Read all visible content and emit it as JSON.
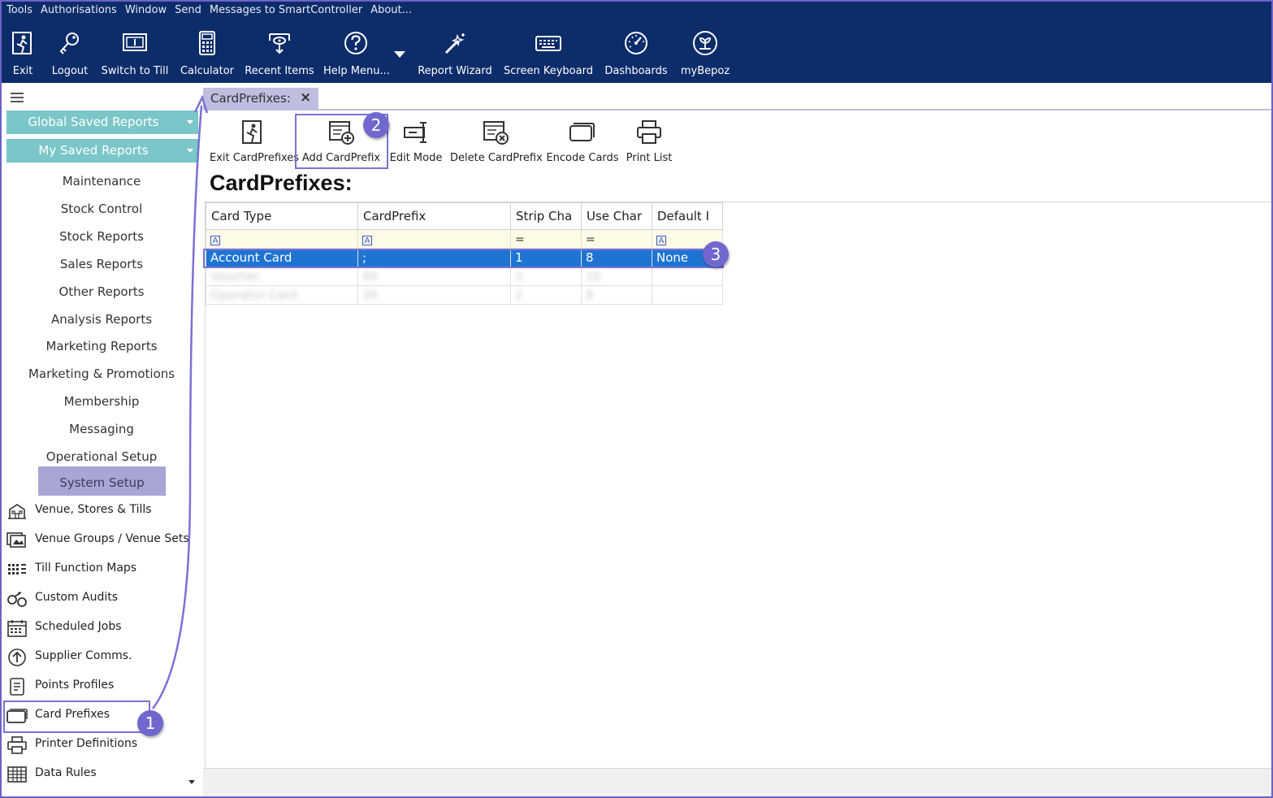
{
  "menubar": {
    "items": [
      "Tools",
      "Authorisations",
      "Window",
      "Send",
      "Messages to SmartController",
      "About..."
    ]
  },
  "toolbar": {
    "buttons": [
      {
        "label": "Exit",
        "icon": "exit-icon"
      },
      {
        "label": "Logout",
        "icon": "key-icon"
      },
      {
        "label": "Switch to Till",
        "icon": "till-icon"
      },
      {
        "label": "Calculator",
        "icon": "calculator-icon"
      },
      {
        "label": "Recent Items",
        "icon": "recent-items-icon"
      },
      {
        "label": "Help Menu...",
        "icon": "help-icon"
      },
      {
        "label": "Report Wizard",
        "icon": "wand-icon"
      },
      {
        "label": "Screen Keyboard",
        "icon": "keyboard-icon"
      },
      {
        "label": "Dashboards",
        "icon": "dashboard-gauge-icon"
      },
      {
        "label": "myBepoz",
        "icon": "mybepoz-logo-icon"
      }
    ]
  },
  "sidebar": {
    "global_saved_reports": "Global Saved Reports",
    "my_saved_reports": "My Saved Reports",
    "categories": [
      "Maintenance",
      "Stock Control",
      "Stock Reports",
      "Sales Reports",
      "Other Reports",
      "Analysis Reports",
      "Marketing Reports",
      "Marketing & Promotions",
      "Membership",
      "Messaging",
      "Operational Setup",
      "System Setup"
    ],
    "selected_category": "System Setup",
    "subitems": [
      {
        "label": "Venue, Stores & Tills",
        "icon": "venue-building-icon"
      },
      {
        "label": "Venue Groups / Venue Sets",
        "icon": "venue-groups-icon"
      },
      {
        "label": "Till Function Maps",
        "icon": "function-map-grid-icon"
      },
      {
        "label": "Custom Audits",
        "icon": "custom-audits-icon"
      },
      {
        "label": "Scheduled Jobs",
        "icon": "calendar-icon"
      },
      {
        "label": "Supplier Comms.",
        "icon": "upload-arrow-icon"
      },
      {
        "label": "Points Profiles",
        "icon": "document-icon"
      },
      {
        "label": "Card Prefixes",
        "icon": "card-icon"
      },
      {
        "label": "Printer Definitions",
        "icon": "printer-icon"
      },
      {
        "label": "Data Rules",
        "icon": "data-grid-icon"
      }
    ]
  },
  "tab": {
    "label": "CardPrefixes:",
    "close": "×"
  },
  "subtoolbar": {
    "buttons": [
      {
        "label": "Exit CardPrefixes",
        "icon": "exit-icon"
      },
      {
        "label": "Add CardPrefix",
        "icon": "add-cardprefix-icon"
      },
      {
        "label": "Edit Mode",
        "icon": "edit-mode-icon"
      },
      {
        "label": "Delete CardPrefix",
        "icon": "delete-cardprefix-icon"
      },
      {
        "label": "Encode Cards",
        "icon": "encode-cards-icon"
      },
      {
        "label": "Print List",
        "icon": "printer-icon"
      }
    ]
  },
  "page_title": "CardPrefixes:",
  "grid": {
    "columns": [
      "Card Type",
      "CardPrefix",
      "Strip Cha",
      "Use Char",
      "Default I"
    ],
    "filters": [
      "A",
      "A",
      "=",
      "=",
      "A"
    ],
    "rows": [
      [
        "Account Card",
        ";",
        "1",
        "8",
        "None"
      ],
      [
        "Voucher",
        "99",
        "2",
        "10",
        ""
      ],
      [
        "Operator Card",
        "30",
        "2",
        "8",
        ""
      ]
    ]
  },
  "annotations": [
    "1",
    "2",
    "3"
  ],
  "colors": {
    "header_bg": "#0d2c6a",
    "saved_reports_bar": "#7bc6c8",
    "selected_category": "#a8a6d6",
    "selected_row": "#1e74d2",
    "annotation": "#7067cf"
  }
}
